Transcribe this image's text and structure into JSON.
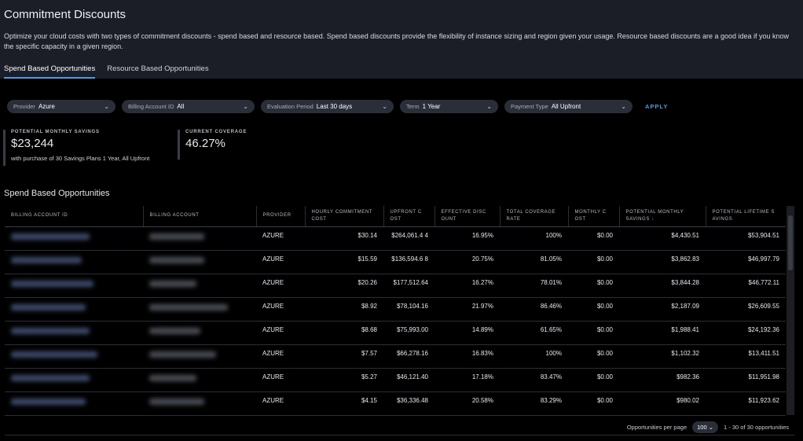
{
  "header": {
    "title": "Commitment Discounts",
    "description": "Optimize your cloud costs with two types of commitment discounts - spend based and resource based. Spend based discounts provide the flexibility of instance sizing and region given your usage. Resource based discounts are a good idea if you know the specific capacity in a given region."
  },
  "tabs": [
    {
      "label": "Spend Based Opportunities",
      "active": true
    },
    {
      "label": "Resource Based Opportunities",
      "active": false
    }
  ],
  "filters": [
    {
      "label": "Provider",
      "value": "Azure"
    },
    {
      "label": "Billing Account ID",
      "value": "All"
    },
    {
      "label": "Evaluation Period",
      "value": "Last 30 days"
    },
    {
      "label": "Term",
      "value": "1 Year"
    },
    {
      "label": "Payment Type",
      "value": "All Upfront"
    }
  ],
  "apply_label": "APPLY",
  "kpis": {
    "savings_label": "POTENTIAL MONTHLY SAVINGS",
    "savings_value": "$23,244",
    "savings_sub": "with purchase of 30 Savings Plans 1 Year, All Upfront",
    "coverage_label": "CURRENT COVERAGE",
    "coverage_value": "46.27%"
  },
  "section_title": "Spend Based Opportunities",
  "columns": [
    "BILLING ACCOUNT ID",
    "BILLING ACCOUNT",
    "PROVIDER",
    "HOURLY COMMITMENT COST",
    "UPFRONT C OST",
    "EFFECTIVE DISC OUNT",
    "TOTAL COVERAGE RATE",
    "MONTHLY C OST",
    "POTENTIAL MONTHLY SAVINGS",
    "POTENTIAL LIFETIME S AVINGS"
  ],
  "rows": [
    [
      "AZURE",
      "$30.14",
      "$264,061.4 4",
      "16.95%",
      "100%",
      "$0.00",
      "$4,430.51",
      "$53,904.51"
    ],
    [
      "AZURE",
      "$15.59",
      "$136,594.6 8",
      "20.75%",
      "81.05%",
      "$0.00",
      "$3,862.83",
      "$46,997.79"
    ],
    [
      "AZURE",
      "$20.26",
      "$177,512.64",
      "16.27%",
      "78.01%",
      "$0.00",
      "$3,844.28",
      "$46,772.11"
    ],
    [
      "AZURE",
      "$8.92",
      "$78,104.16",
      "21.97%",
      "86.46%",
      "$0.00",
      "$2,187.09",
      "$26,609.55"
    ],
    [
      "AZURE",
      "$8.68",
      "$75,993.00",
      "14.89%",
      "61.65%",
      "$0.00",
      "$1,988.41",
      "$24,192.36"
    ],
    [
      "AZURE",
      "$7.57",
      "$66,278.16",
      "16.83%",
      "100%",
      "$0.00",
      "$1,102.32",
      "$13,411.51"
    ],
    [
      "AZURE",
      "$5.27",
      "$46,121.40",
      "17.18%",
      "83.47%",
      "$0.00",
      "$982.36",
      "$11,951.98"
    ],
    [
      "AZURE",
      "$4.15",
      "$36,336.48",
      "20.58%",
      "83.29%",
      "$0.00",
      "$980.02",
      "$11,923.62"
    ]
  ],
  "pager": {
    "per_page_label": "Opportunities per page",
    "per_page": "100",
    "range": "1 - 30 of 30 opportunities"
  }
}
